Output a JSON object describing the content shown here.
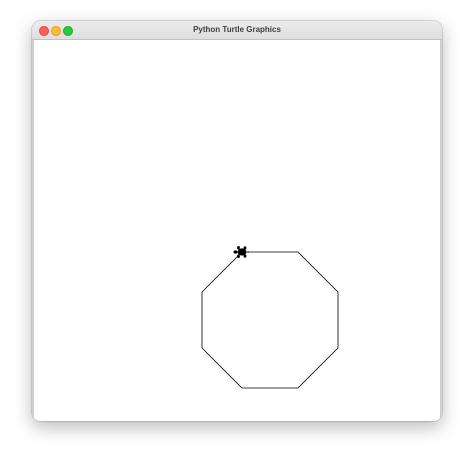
{
  "window": {
    "title": "Python Turtle Graphics"
  },
  "traffic_lights": {
    "close_color": "#fe5f57",
    "minimize_color": "#febc2e",
    "maximize_color": "#28c840"
  },
  "canvas": {
    "background": "#ffffff",
    "drawing": {
      "shape": "octagon",
      "stroke": "#000000"
    },
    "turtle": {
      "shape": "turtle",
      "color": "#000000",
      "heading": "west"
    }
  }
}
